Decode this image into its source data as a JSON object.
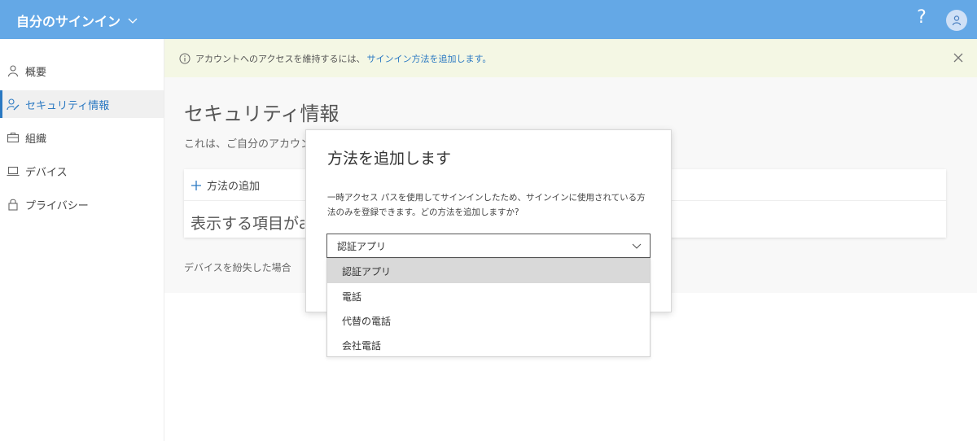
{
  "header": {
    "app_title": "自分のサインイン",
    "help_label": "?",
    "colors": {
      "bar": "#64a8e6"
    }
  },
  "sidebar": {
    "items": [
      {
        "label": "概要",
        "icon": "person-icon"
      },
      {
        "label": "セキュリティ情報",
        "icon": "person-edit-icon",
        "active": true
      },
      {
        "label": "組織",
        "icon": "briefcase-icon"
      },
      {
        "label": "デバイス",
        "icon": "laptop-icon"
      },
      {
        "label": "プライバシー",
        "icon": "lock-icon"
      }
    ]
  },
  "notice": {
    "text": "アカウントへのアクセスを維持するには、",
    "link": "サインイン方法を追加します。"
  },
  "main": {
    "title": "セキュリティ情報",
    "description": "これは、ご自分のアカウン",
    "add_method": "方法の追加",
    "empty": "表示する項目がa",
    "lost_device": "デバイスを紛失した場合"
  },
  "dialog": {
    "title": "方法を追加します",
    "body": "一時アクセス パスを使用してサインインしたため、サインインに使用されている方法のみを登録できます。どの方法を追加しますか?",
    "select_value": "認証アプリ",
    "options": [
      "認証アプリ",
      "電話",
      "代替の電話",
      "会社電話"
    ],
    "selected_index": 0
  }
}
